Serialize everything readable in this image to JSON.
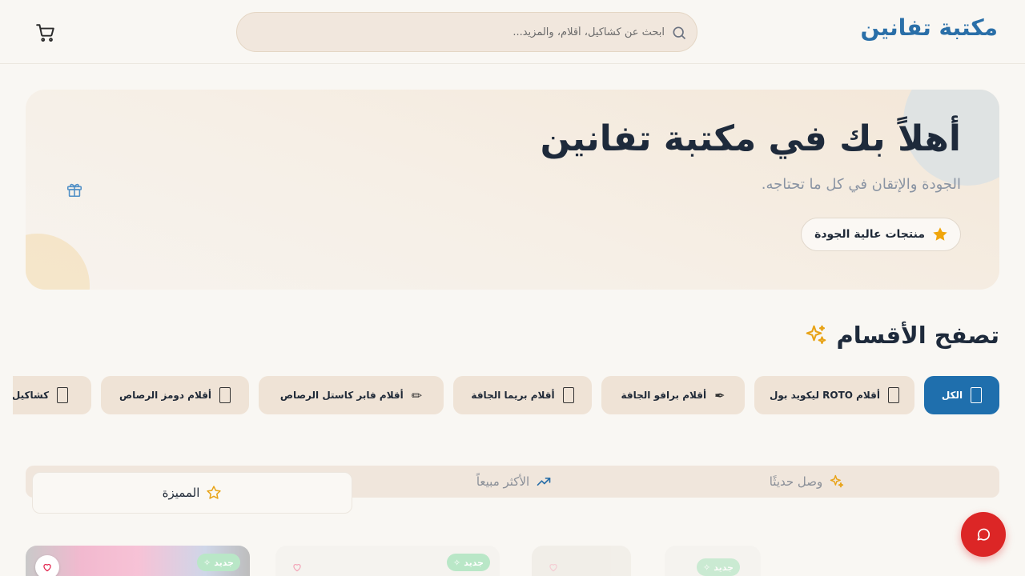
{
  "header": {
    "logo": "مكتبة تفانين",
    "search_placeholder": "ابحث عن كشاكيل، أقلام، والمزيد..."
  },
  "hero": {
    "title": "أهلاً بك في مكتبة تفانين",
    "subtitle": "الجودة والإتقان في كل ما تحتاجه.",
    "badge": "منتجات عالية الجودة"
  },
  "categories": {
    "title": "تصفح الأقسام",
    "items": [
      {
        "label": "الكل",
        "icon": "box-icon",
        "active": true
      },
      {
        "label": "أقلام ROTO ليكويد بول",
        "icon": "box-icon"
      },
      {
        "label": "أقلام برافو الجافة",
        "icon": "fountain-pen-icon"
      },
      {
        "label": "أقلام بريما الجافة",
        "icon": "box-icon"
      },
      {
        "label": "أقلام فابر كاستل الرصاص",
        "icon": "pencil-icon"
      },
      {
        "label": "أقلام دومز الرصاص",
        "icon": "box-icon"
      },
      {
        "label": "كشاكيل",
        "icon": "box-icon"
      }
    ]
  },
  "tabs": {
    "featured": "المميزة",
    "best_selling": "الأكثر مبيعاً",
    "new_arrivals": "وصل حديثًا"
  },
  "products": {
    "new_badge": "جديد"
  },
  "colors": {
    "brand": "#2a6fa8",
    "active_category": "#1f6fad",
    "chat": "#dc2626",
    "star": "#f0a50a"
  }
}
